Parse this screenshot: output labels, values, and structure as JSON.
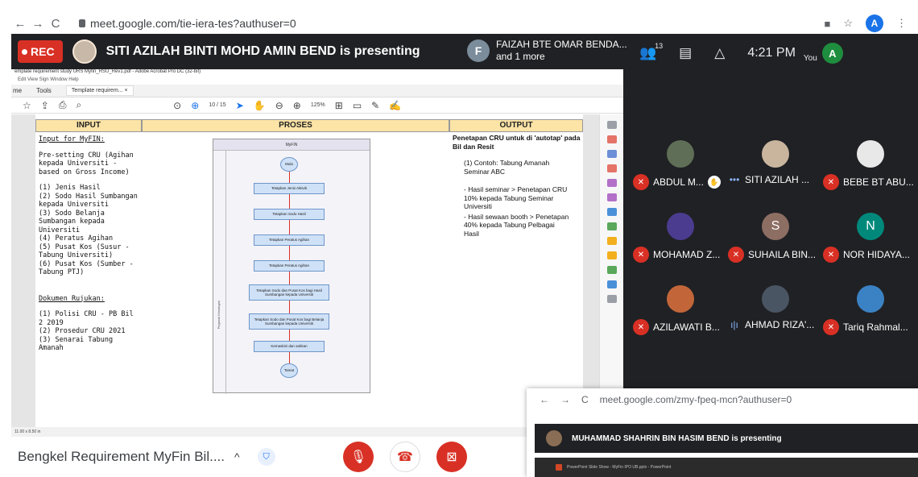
{
  "browser": {
    "back": "←",
    "forward": "→",
    "reload": "C",
    "url": "meet.google.com/tie-iera-tes?authuser=0",
    "camera_icon": "■",
    "star_icon": "☆",
    "avatar_letter": "A",
    "menu_icon": "⋮"
  },
  "meet": {
    "rec_label": "REC",
    "presenting_text": "SITI AZILAH BINTI MOHD AMIN BEND is presenting",
    "other_presenter_letter": "F",
    "other_presenter_name": "FAIZAH BTE OMAR BENDA...",
    "other_presenter_more": "and 1 more",
    "participants_icon": "👥",
    "participants_count": "13",
    "chat_icon": "▤",
    "activities_icon": "△",
    "time": "4:21 PM",
    "you_label": "You",
    "you_avatar": "A",
    "meeting_name": "Bengkel Requirement MyFin Bil....",
    "caret": "^",
    "shield_icon": "⛉",
    "mic_icon": "🎙",
    "hangup_icon": "☎",
    "camera_off_icon": "⊠"
  },
  "acrobat": {
    "title": "emplate requirement study URS Myfin_RSU_Rev1.pdf - Adobe Acrobat Pro DC (32-bit)",
    "menu": "Edit  View  Sign  Window  Help",
    "tab_home": "me",
    "tab_tools": "Tools",
    "tab_doc": "Template requirem...  ×",
    "page_indicator": "10  /  15",
    "zoom": "125%",
    "footer": "11.00 x 8.50 in"
  },
  "document": {
    "hdr_input": "INPUT",
    "hdr_proses": "PROSES",
    "hdr_output": "OUTPUT",
    "input_heading": "Input for MyFIN:",
    "input_intro": "Pre-setting CRU (Agihan kepada Universiti - based on Gross Income)",
    "input_items": [
      "(1)  Jenis Hasil",
      "(2)  Sodo Hasil Sumbangan kepada Universiti",
      "(3)  Sodo Belanja Sumbangan kepada Universiti",
      "(4)  Peratus Agihan",
      "(5)  Pusat Kos (Susur - Tabung Universiti)",
      "(6)  Pusat Kos (Sumber - Tabung PTJ)"
    ],
    "rujukan_heading": "Dokumen Rujukan:",
    "rujukan_items": [
      "(1)  Polisi CRU - PB Bil 2 2019",
      "(2)  Prosedur CRU 2021",
      "(3)  Senarai Tabung Amanah"
    ],
    "output_heading": "Penetapan CRU untuk di 'autotap' pada Bil dan Resit",
    "output_contoh": "(1) Contoh: Tabung Amanah Seminar ABC",
    "output_bullets": [
      "-  Hasil seminar > Penetapan CRU 10% kepada Tabung Seminar Universiti",
      "-  Hasil sewaan booth > Penetapan 40% kepada Tabung Pelbagai Hasil"
    ],
    "flow_title": "MyFIN",
    "flow_lane": "Pegawai Kewangan",
    "flow_nodes": [
      "Mula",
      "Tetapkan Jenis Aktiviti",
      "Tetapkan Sodo Hasil",
      "Tetapkan Peratus Agihan",
      "Tetapkan Peratus Agihan",
      "Tetapkan Sodo dan Pusat Kos bagi Hasil Sumbangan kepada Universiti",
      "Tetapkan Sodo dan Pusat Kos bagi Belanja Sumbangan kepada Universiti",
      "Kemaskini dan sahkan",
      "Tamat"
    ]
  },
  "participants": [
    {
      "name": "ABDUL M...",
      "mic": "off",
      "color": "#5f6f57",
      "initial": ""
    },
    {
      "name": "SITI AZILAH ...",
      "mic": "dots",
      "color": "#c9b59e",
      "initial": ""
    },
    {
      "name": "BEBE BT ABU...",
      "mic": "off",
      "color": "#e8e8e8",
      "initial": ""
    },
    {
      "name": "MOHAMAD Z...",
      "mic": "off",
      "color": "#4b3c8f",
      "initial": ""
    },
    {
      "name": "SUHAILA BIN...",
      "mic": "off",
      "color": "#8d6e63",
      "initial": "S"
    },
    {
      "name": "NOR HIDAYA...",
      "mic": "off",
      "color": "#00897b",
      "initial": "N"
    },
    {
      "name": "AZILAWATI B...",
      "mic": "off",
      "color": "#c2663a",
      "initial": ""
    },
    {
      "name": "AHMAD RIZA'...",
      "mic": "on",
      "color": "#4a5563",
      "initial": ""
    },
    {
      "name": "Tariq Rahmal...",
      "mic": "off",
      "color": "#3b82c4",
      "initial": ""
    }
  ],
  "popup": {
    "url": "meet.google.com/zmy-fpeq-mcn?authuser=0",
    "presenting_text": "MUHAMMAD SHAHRIN BIN HASIM BEND is presenting",
    "ppt_text": "PowerPoint Slide Show  -  MyFin IPO UB.pptx  -  PowerPoint"
  }
}
